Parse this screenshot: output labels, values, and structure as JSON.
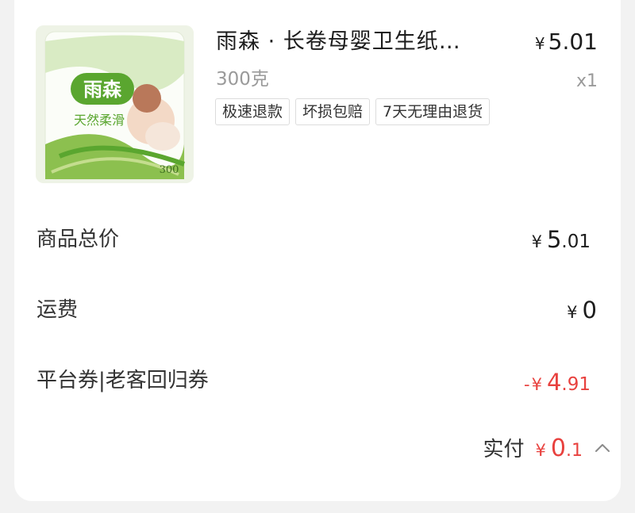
{
  "product": {
    "title": "雨森 · 长卷母婴卫生纸…",
    "spec": "300克",
    "price_symbol": "¥",
    "price": "5.01",
    "quantity": "x1",
    "tags": [
      "极速退款",
      "坏损包赔",
      "7天无理由退货"
    ],
    "image": {
      "brand": "雨森",
      "tagline": "天然柔滑",
      "count": "300"
    }
  },
  "summary": {
    "goods_total": {
      "label": "商品总价",
      "symbol": "¥",
      "int": "5",
      "dec": ".01"
    },
    "shipping": {
      "label": "运费",
      "symbol": "¥",
      "int": "0",
      "dec": ""
    },
    "coupon": {
      "label": "平台券|老客回归券",
      "sign": "-",
      "symbol": "¥",
      "int": "4",
      "dec": ".91"
    },
    "paid": {
      "label": "实付",
      "symbol": "¥",
      "int": "0",
      "dec": ".1"
    }
  },
  "colors": {
    "accent_red": "#e8413e",
    "brand_green": "#5aa62f"
  },
  "icons": {
    "paid_toggle": "chevron-up-icon"
  }
}
